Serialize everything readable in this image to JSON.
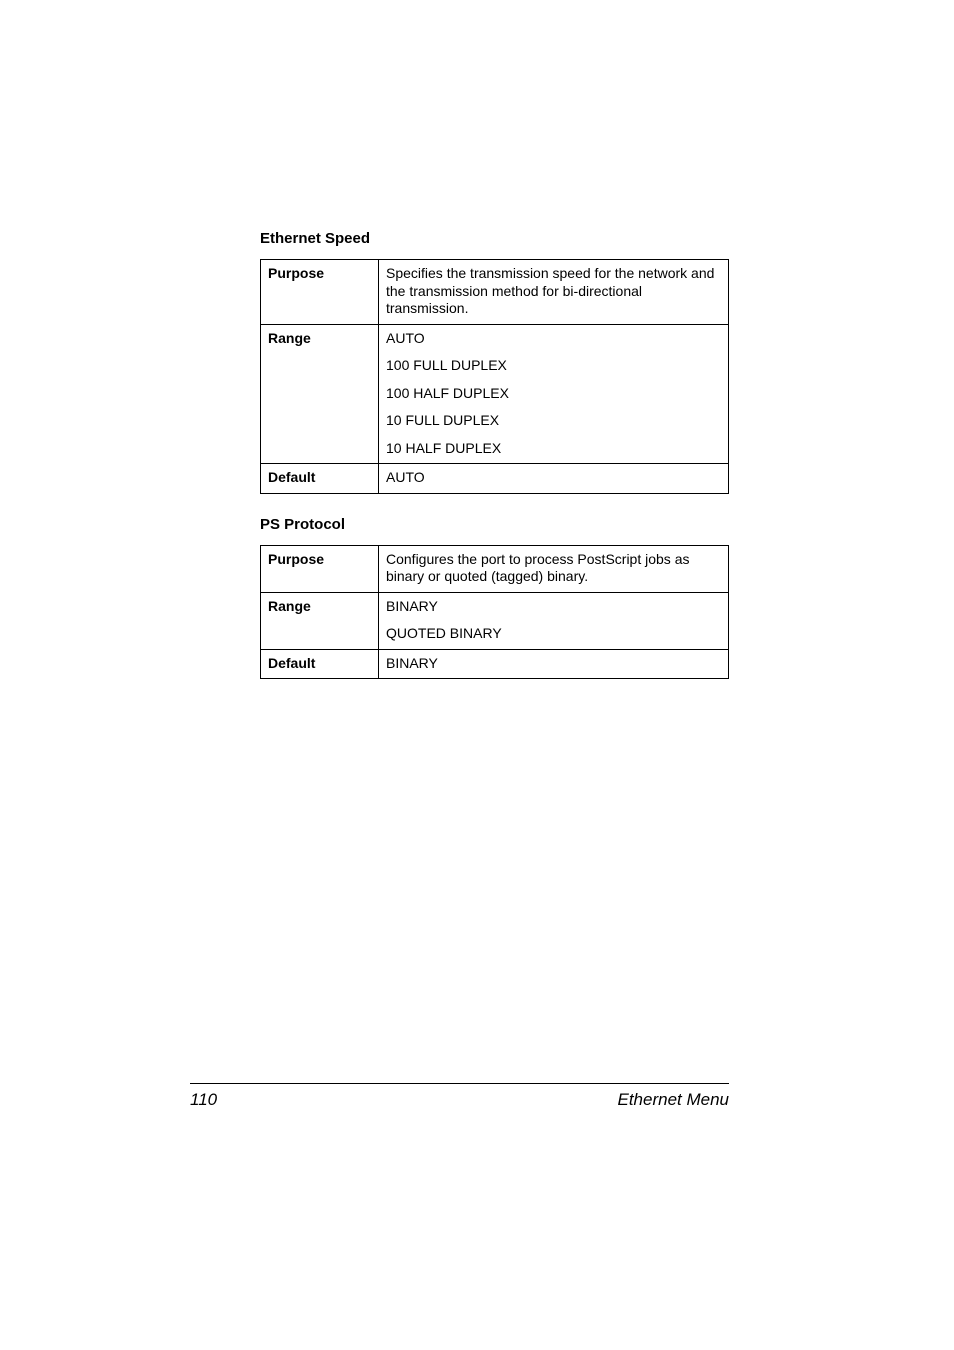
{
  "sections": {
    "ethernet_speed": {
      "heading": "Ethernet Speed",
      "purpose_label": "Purpose",
      "purpose_value": "Specifies the transmission speed for the network and the transmission method for bi-directional transmission.",
      "range_label": "Range",
      "range_values": {
        "v0": "AUTO",
        "v1": "100 FULL DUPLEX",
        "v2": "100 HALF DUPLEX",
        "v3": "10 FULL DUPLEX",
        "v4": "10 HALF DUPLEX"
      },
      "default_label": "Default",
      "default_value": "AUTO"
    },
    "ps_protocol": {
      "heading": "PS Protocol",
      "purpose_label": "Purpose",
      "purpose_value": "Configures the port to process PostScript jobs as binary or quoted (tagged) binary.",
      "range_label": "Range",
      "range_values": {
        "v0": "BINARY",
        "v1": "QUOTED BINARY"
      },
      "default_label": "Default",
      "default_value": "BINARY"
    }
  },
  "footer": {
    "page_number": "110",
    "section_title": "Ethernet Menu"
  }
}
